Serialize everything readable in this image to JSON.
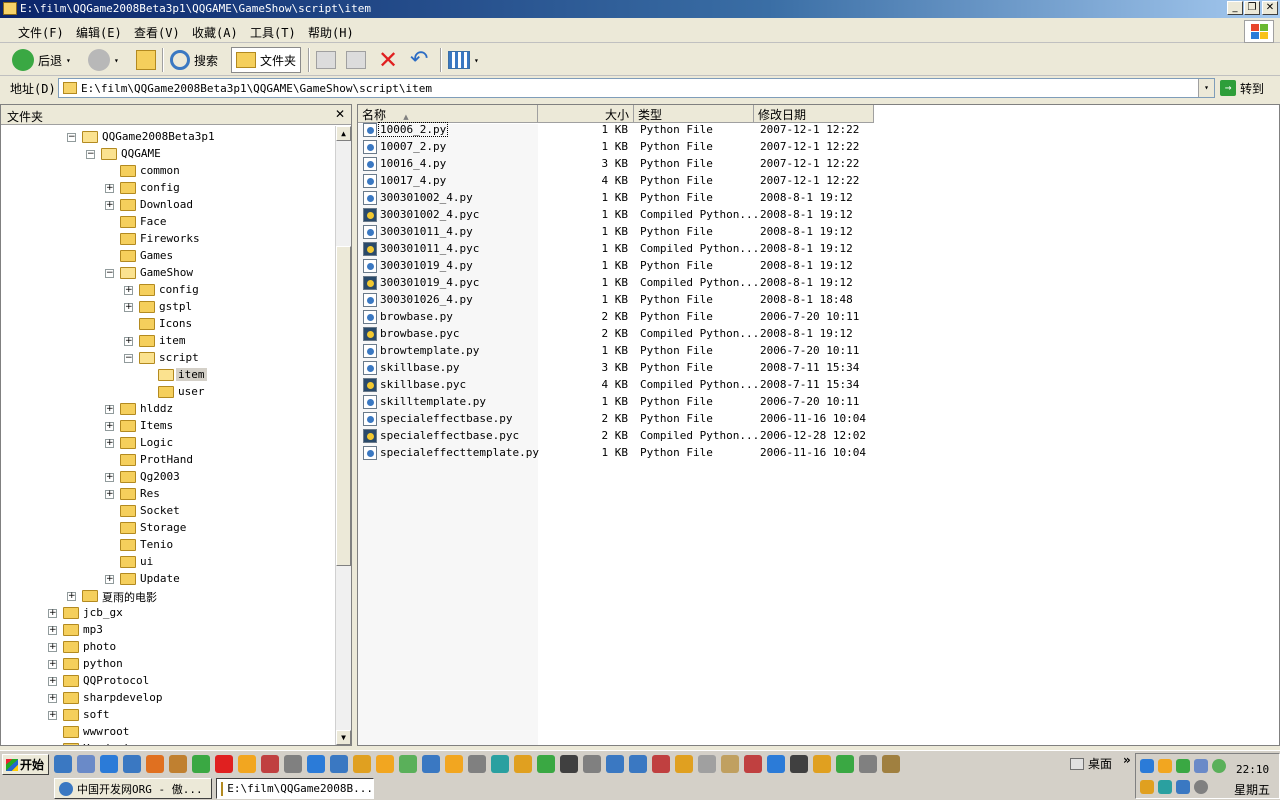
{
  "window": {
    "title": "E:\\film\\QQGame2008Beta3p1\\QQGAME\\GameShow\\script\\item",
    "controls": {
      "minimize": "_",
      "maximize": "❐",
      "close": "✕"
    }
  },
  "menu": [
    "文件(F)",
    "编辑(E)",
    "查看(V)",
    "收藏(A)",
    "工具(T)",
    "帮助(H)"
  ],
  "toolbar": {
    "back_label": "后退",
    "search_label": "搜索",
    "folders_label": "文件夹",
    "dropdown": "▾"
  },
  "address": {
    "label": "地址(D)",
    "value": "E:\\film\\QQGame2008Beta3p1\\QQGAME\\GameShow\\script\\item",
    "go_label": "转到"
  },
  "folder_pane": {
    "title": "文件夹",
    "close": "✕",
    "items": [
      {
        "label": "QQGame2008Beta3p1",
        "exp": "⊟"
      },
      {
        "label": "QQGAME",
        "exp": "⊟"
      },
      {
        "label": "common",
        "exp": ""
      },
      {
        "label": "config",
        "exp": "+"
      },
      {
        "label": "Download",
        "exp": "+"
      },
      {
        "label": "Face",
        "exp": ""
      },
      {
        "label": "Fireworks",
        "exp": ""
      },
      {
        "label": "Games",
        "exp": ""
      },
      {
        "label": "GameShow",
        "exp": "-"
      },
      {
        "label": "config",
        "exp": "+"
      },
      {
        "label": "gstpl",
        "exp": "+"
      },
      {
        "label": "Icons",
        "exp": ""
      },
      {
        "label": "item",
        "exp": "+"
      },
      {
        "label": "script",
        "exp": "-"
      },
      {
        "label": "item",
        "exp": ""
      },
      {
        "label": "user",
        "exp": ""
      },
      {
        "label": "hlddz",
        "exp": "+"
      },
      {
        "label": "Items",
        "exp": "+"
      },
      {
        "label": "Logic",
        "exp": "+"
      },
      {
        "label": "ProtHand",
        "exp": ""
      },
      {
        "label": "Qg2003",
        "exp": "+"
      },
      {
        "label": "Res",
        "exp": "+"
      },
      {
        "label": "Socket",
        "exp": ""
      },
      {
        "label": "Storage",
        "exp": ""
      },
      {
        "label": "Tenio",
        "exp": ""
      },
      {
        "label": "ui",
        "exp": ""
      },
      {
        "label": "Update",
        "exp": "+"
      },
      {
        "label": "夏雨的电影",
        "exp": "+"
      },
      {
        "label": "jcb_gx",
        "exp": "+"
      },
      {
        "label": "mp3",
        "exp": "+"
      },
      {
        "label": "photo",
        "exp": "+"
      },
      {
        "label": "python",
        "exp": "+"
      },
      {
        "label": "QQProtocol",
        "exp": "+"
      },
      {
        "label": "sharpdevelop",
        "exp": "+"
      },
      {
        "label": "soft",
        "exp": "+"
      },
      {
        "label": "wwwroot",
        "exp": ""
      },
      {
        "label": "Xzcdesi",
        "exp": ""
      }
    ],
    "scroll_up": "▲",
    "scroll_down": "▼"
  },
  "file_list": {
    "columns": {
      "name": "名称",
      "sort": "▲",
      "size": "大小",
      "type": "类型",
      "date": "修改日期"
    },
    "rows": [
      {
        "name": "10006_2.py",
        "size": "1 KB",
        "type": "Python File",
        "date": "2007-12-1 12:22",
        "kind": "py"
      },
      {
        "name": "10007_2.py",
        "size": "1 KB",
        "type": "Python File",
        "date": "2007-12-1 12:22",
        "kind": "py"
      },
      {
        "name": "10016_4.py",
        "size": "3 KB",
        "type": "Python File",
        "date": "2007-12-1 12:22",
        "kind": "py"
      },
      {
        "name": "10017_4.py",
        "size": "4 KB",
        "type": "Python File",
        "date": "2007-12-1 12:22",
        "kind": "py"
      },
      {
        "name": "300301002_4.py",
        "size": "1 KB",
        "type": "Python File",
        "date": "2008-8-1 19:12",
        "kind": "py"
      },
      {
        "name": "300301002_4.pyc",
        "size": "1 KB",
        "type": "Compiled Python...",
        "date": "2008-8-1 19:12",
        "kind": "pyc"
      },
      {
        "name": "300301011_4.py",
        "size": "1 KB",
        "type": "Python File",
        "date": "2008-8-1 19:12",
        "kind": "py"
      },
      {
        "name": "300301011_4.pyc",
        "size": "1 KB",
        "type": "Compiled Python...",
        "date": "2008-8-1 19:12",
        "kind": "pyc"
      },
      {
        "name": "300301019_4.py",
        "size": "1 KB",
        "type": "Python File",
        "date": "2008-8-1 19:12",
        "kind": "py"
      },
      {
        "name": "300301019_4.pyc",
        "size": "1 KB",
        "type": "Compiled Python...",
        "date": "2008-8-1 19:12",
        "kind": "pyc"
      },
      {
        "name": "300301026_4.py",
        "size": "1 KB",
        "type": "Python File",
        "date": "2008-8-1 18:48",
        "kind": "py"
      },
      {
        "name": "browbase.py",
        "size": "2 KB",
        "type": "Python File",
        "date": "2006-7-20 10:11",
        "kind": "py"
      },
      {
        "name": "browbase.pyc",
        "size": "2 KB",
        "type": "Compiled Python...",
        "date": "2008-8-1 19:12",
        "kind": "pyc"
      },
      {
        "name": "browtemplate.py",
        "size": "1 KB",
        "type": "Python File",
        "date": "2006-7-20 10:11",
        "kind": "py"
      },
      {
        "name": "skillbase.py",
        "size": "3 KB",
        "type": "Python File",
        "date": "2008-7-11 15:34",
        "kind": "py"
      },
      {
        "name": "skillbase.pyc",
        "size": "4 KB",
        "type": "Compiled Python...",
        "date": "2008-7-11 15:34",
        "kind": "pyc"
      },
      {
        "name": "skilltemplate.py",
        "size": "1 KB",
        "type": "Python File",
        "date": "2006-7-20 10:11",
        "kind": "py"
      },
      {
        "name": "specialeffectbase.py",
        "size": "2 KB",
        "type": "Python File",
        "date": "2006-11-16 10:04",
        "kind": "py"
      },
      {
        "name": "specialeffectbase.pyc",
        "size": "2 KB",
        "type": "Compiled Python...",
        "date": "2006-12-28 12:02",
        "kind": "pyc"
      },
      {
        "name": "specialeffecttemplate.py",
        "size": "1 KB",
        "type": "Python File",
        "date": "2006-11-16 10:04",
        "kind": "py"
      }
    ]
  },
  "taskbar": {
    "start_label": "开始",
    "tasks": [
      {
        "label": "中国开发网ORG - 傲..."
      },
      {
        "label": "E:\\film\\QQGame2008B..."
      }
    ],
    "desktop_label": "桌面",
    "chevron": "»",
    "clock": "22:10",
    "weekday": "星期五"
  }
}
